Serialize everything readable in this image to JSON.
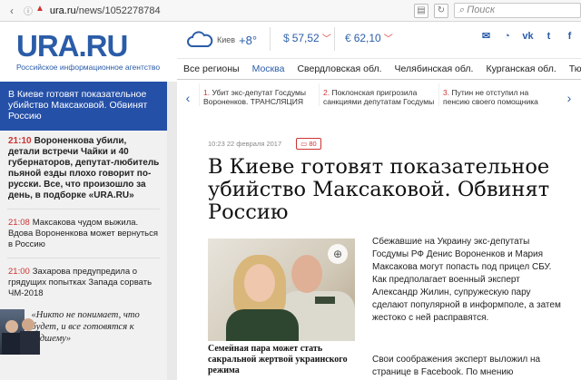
{
  "browser": {
    "url_domain": "ura.ru",
    "url_path": "/news/1052278784",
    "search_placeholder": "Поиск"
  },
  "logo": {
    "title": "URA.RU",
    "subtitle": "Российское информационное агентство"
  },
  "weather": {
    "city": "Киев",
    "temp": "+8°"
  },
  "currencies": [
    {
      "symbol": "$",
      "value": "57,52",
      "trend": "down"
    },
    {
      "symbol": "€",
      "value": "62,10",
      "trend": "down"
    }
  ],
  "social_icons": [
    "mail-icon",
    "rss-icon",
    "vk-icon",
    "twitter-icon",
    "facebook-icon"
  ],
  "regions": [
    {
      "label": "Все регионы",
      "active": false
    },
    {
      "label": "Москва",
      "active": true
    },
    {
      "label": "Свердловская обл.",
      "active": false
    },
    {
      "label": "Челябинская обл.",
      "active": false
    },
    {
      "label": "Курганская обл.",
      "active": false
    },
    {
      "label": "Тюменская",
      "active": false
    }
  ],
  "sidebar": {
    "lead": "В Киеве готовят показательное убийство Максаковой. Обвинят Россию",
    "items": [
      {
        "time": "21:10",
        "text": "Вороненкова убили, детали встречи Чайки и 40 губернаторов, депутат-любитель пьяной езды плохо говорит по-русски. Все, что произошло за день, в подборке «URA.RU»",
        "bold": true
      },
      {
        "time": "21:08",
        "text": "Максакова чудом выжила. Вдова Вороненкова может вернуться в Россию",
        "bold": false
      },
      {
        "time": "21:00",
        "text": "Захарова предупредила о грядущих попытках Запада сорвать ЧМ-2018",
        "bold": false
      }
    ],
    "quote": "«Никто не понимает, что будет, и все готовятся к худшему»"
  },
  "related": [
    {
      "num": "1.",
      "text": "Убит экс-депутат Госдумы Вороненков. ТРАНСЛЯЦИЯ"
    },
    {
      "num": "2.",
      "text": "Поклонская пригрозила санкциями депутатам Госдумы"
    },
    {
      "num": "3.",
      "text": "Путин не отступил на пенсию своего помощника"
    }
  ],
  "article": {
    "date": "10:23  22 февраля 2017",
    "comments": "80",
    "title": "В Киеве готовят показательное убийство Максаковой. Обвинят Россию",
    "photo_caption": "Семейная пара может стать сакральной жертвой украинского режима",
    "lead": "Сбежавшие на Украину экс-депутаты Госдумы РФ Денис Вороненков и Мария Максакова могут попасть под прицел СБУ. Как предполагает военный эксперт Александр Жилин, супружескую пару сделают популярной в информполе, а затем жестоко с ней расправятся.",
    "body": "Свои соображения эксперт выложил на странице в Facebook. По мнению"
  },
  "colors": {
    "brand": "#2a5ca8",
    "accent_red": "#cc3333",
    "sidebar_lead_bg": "#2550a8"
  }
}
